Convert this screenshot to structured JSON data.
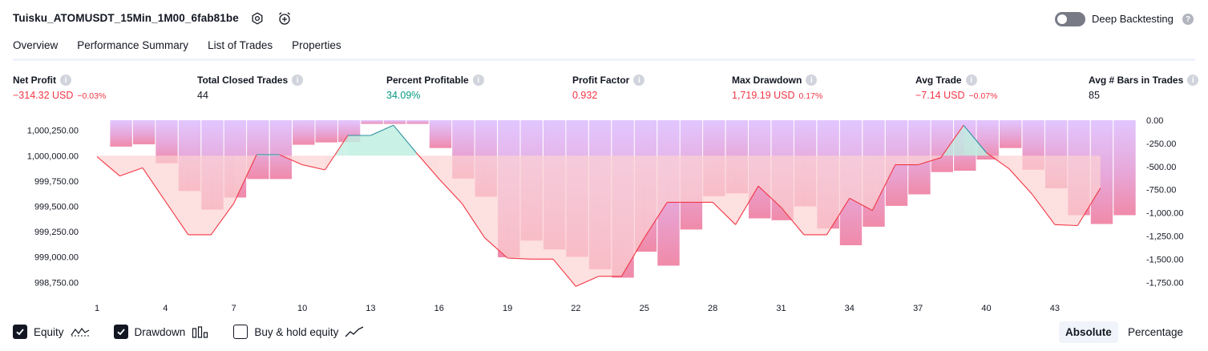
{
  "header": {
    "strategy_title": "Tuisku_ATOMUSDT_15Min_1M00_6fab81be",
    "deep_backtesting_label": "Deep Backtesting",
    "deep_backtesting_enabled": false
  },
  "tabs": [
    {
      "label": "Overview",
      "active": true
    },
    {
      "label": "Performance Summary",
      "active": false
    },
    {
      "label": "List of Trades",
      "active": false
    },
    {
      "label": "Properties",
      "active": false
    }
  ],
  "metrics": {
    "net_profit": {
      "label": "Net Profit",
      "value": "−314.32 USD",
      "pct": "−0.03%"
    },
    "total_closed_trades": {
      "label": "Total Closed Trades",
      "value": "44"
    },
    "percent_profitable": {
      "label": "Percent Profitable",
      "value": "34.09%"
    },
    "profit_factor": {
      "label": "Profit Factor",
      "value": "0.932"
    },
    "max_drawdown": {
      "label": "Max Drawdown",
      "value": "1,719.19 USD",
      "pct": "0.17%"
    },
    "avg_trade": {
      "label": "Avg Trade",
      "value": "−7.14 USD",
      "pct": "−0.07%"
    },
    "avg_bars": {
      "label": "Avg # Bars in Trades",
      "value": "85"
    }
  },
  "chart_data": {
    "type": "bar",
    "x_ticks": [
      "1",
      "4",
      "7",
      "10",
      "13",
      "16",
      "19",
      "22",
      "25",
      "28",
      "31",
      "34",
      "37",
      "40",
      "43"
    ],
    "left_axis": {
      "ticks": [
        "1,000,250.00",
        "1,000,000.00",
        "999,750.00",
        "999,500.00",
        "999,250.00",
        "999,000.00",
        "998,750.00"
      ],
      "range": [
        998650,
        1000350
      ]
    },
    "right_axis": {
      "ticks": [
        "0.00",
        "-250.00",
        "-500.00",
        "-750.00",
        "-1,000.00",
        "-1,250.00",
        "-1,500.00",
        "-1,750.00"
      ],
      "range": [
        -1860,
        0
      ]
    },
    "series": [
      {
        "name": "Equity",
        "type": "line",
        "x": [
          1,
          2,
          3,
          4,
          5,
          6,
          7,
          8,
          9,
          10,
          11,
          12,
          13,
          14,
          15,
          16,
          17,
          18,
          19,
          20,
          21,
          22,
          23,
          24,
          25,
          26,
          27,
          28,
          29,
          30,
          31,
          32,
          33,
          34,
          35,
          36,
          37,
          38,
          39,
          40,
          41,
          42,
          43,
          44,
          45
        ],
        "values": [
          999990,
          999800,
          999880,
          999550,
          999220,
          999220,
          999530,
          1000010,
          1000010,
          999910,
          999860,
          1000200,
          1000200,
          1000300,
          1000030,
          999770,
          999530,
          999190,
          998990,
          998980,
          998980,
          998710,
          998810,
          998810,
          999190,
          999540,
          999540,
          999540,
          999320,
          999700,
          999490,
          999220,
          999220,
          999580,
          999460,
          999910,
          999910,
          999980,
          1000300,
          1000030,
          999870,
          999620,
          999320,
          999310,
          999680
        ]
      },
      {
        "name": "Drawdown",
        "type": "bar",
        "values": [
          0,
          -285,
          -260,
          -465,
          -765,
          -965,
          -835,
          -635,
          -635,
          -265,
          -240,
          -235,
          -40,
          -40,
          -40,
          -300,
          -630,
          -825,
          -1480,
          -1300,
          -1395,
          -1475,
          -1610,
          -1700,
          -1420,
          -1570,
          -1180,
          -820,
          -790,
          -1060,
          -1080,
          -930,
          -1170,
          -1350,
          -1150,
          -925,
          -800,
          -560,
          -545,
          -425,
          -300,
          -535,
          -735,
          -1025,
          -1120,
          -1025
        ]
      }
    ],
    "grid": false
  },
  "legend": {
    "equity": {
      "label": "Equity",
      "checked": true
    },
    "drawdown": {
      "label": "Drawdown",
      "checked": true
    },
    "buy_hold": {
      "label": "Buy & hold equity",
      "checked": false
    }
  },
  "view_mode": {
    "absolute_label": "Absolute",
    "percentage_label": "Percentage",
    "active": "Absolute"
  },
  "colors": {
    "negative": "#f23645",
    "positive": "#089981",
    "drawdown_bar": "#d1b3ff",
    "equity_line": "#f23645",
    "equity_line_up": "#2e8fa0"
  }
}
